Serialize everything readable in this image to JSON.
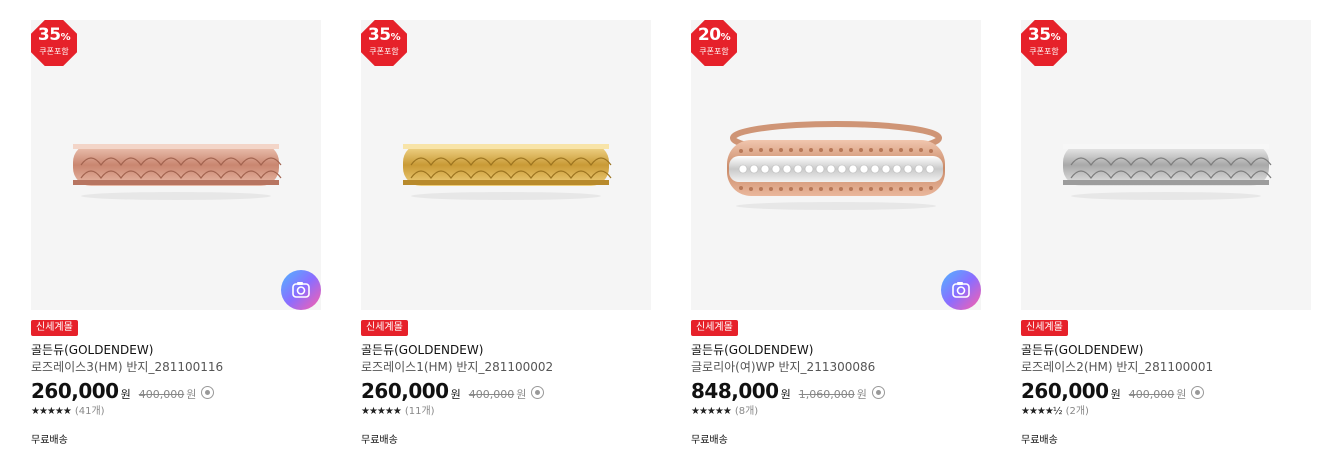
{
  "products": [
    {
      "discount": "35",
      "discount_unit": "%",
      "discount_sub": "쿠폰포함",
      "ring_metal": "#d8a18c",
      "has_camera": true,
      "tag": "신세계몰",
      "brand": "골든듀(GOLDENDEW)",
      "name": "로즈레이스3(HM) 반지_281100116",
      "price": "260,000",
      "price_unit": "원",
      "original_price": "400,000",
      "original_unit": "원",
      "stars": "★★★★★",
      "reviews": "(41개)",
      "shipping": "무료배송"
    },
    {
      "discount": "35",
      "discount_unit": "%",
      "discount_sub": "쿠폰포함",
      "ring_metal": "#e2bd62",
      "has_camera": false,
      "tag": "신세계몰",
      "brand": "골든듀(GOLDENDEW)",
      "name": "로즈레이스1(HM) 반지_281100002",
      "price": "260,000",
      "price_unit": "원",
      "original_price": "400,000",
      "original_unit": "원",
      "stars": "★★★★★",
      "reviews": "(11개)",
      "shipping": "무료배송"
    },
    {
      "discount": "20",
      "discount_unit": "%",
      "discount_sub": "쿠폰포함",
      "ring_metal": "#d39a7d",
      "has_camera": true,
      "tag": "신세계몰",
      "brand": "골든듀(GOLDENDEW)",
      "name": "글로리아(여)WP 반지_211300086",
      "price": "848,000",
      "price_unit": "원",
      "original_price": "1,060,000",
      "original_unit": "원",
      "stars": "★★★★★",
      "reviews": "(8개)",
      "shipping": "무료배송"
    },
    {
      "discount": "35",
      "discount_unit": "%",
      "discount_sub": "쿠폰포함",
      "ring_metal": "#c8c8c8",
      "has_camera": false,
      "tag": "신세계몰",
      "brand": "골든듀(GOLDENDEW)",
      "name": "로즈레이스2(HM) 반지_281100001",
      "price": "260,000",
      "price_unit": "원",
      "original_price": "400,000",
      "original_unit": "원",
      "stars": "★★★★½",
      "reviews": "(2개)",
      "shipping": "무료배송"
    }
  ],
  "colors": {
    "accent": "#e6212a",
    "thumb_bg": "#f5f5f5"
  },
  "icons": {
    "camera": "camera-icon",
    "info": "info-circle-icon"
  }
}
